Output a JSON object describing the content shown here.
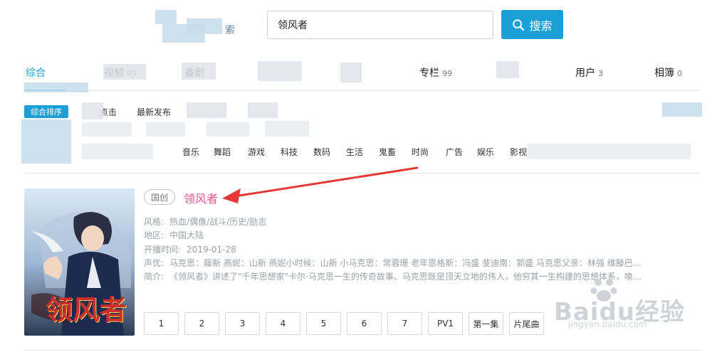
{
  "header": {
    "logo_partial": "索",
    "search": {
      "value": "领风者",
      "button_label": "搜索"
    }
  },
  "tabs": [
    {
      "label": "综合",
      "count": ""
    },
    {
      "label": "视频",
      "count": "99"
    },
    {
      "label": "番剧",
      "count": ""
    },
    {
      "label": "专栏",
      "count": "99"
    },
    {
      "label": "用户",
      "count": "3"
    },
    {
      "label": "相簿",
      "count": "0"
    }
  ],
  "filters": {
    "sort_badge": "综合排序",
    "items": [
      "点击",
      "最新发布"
    ]
  },
  "categories": [
    "音乐",
    "舞蹈",
    "游戏",
    "科技",
    "数码",
    "生活",
    "鬼畜",
    "时尚",
    "广告",
    "娱乐",
    "影视"
  ],
  "result": {
    "tag": "国创",
    "title": "领风者",
    "style_label": "风格:",
    "style_value": "热血/偶像/战斗/历史/励志",
    "region_label": "地区:",
    "region_value": "中国大陆",
    "date_label": "开播时间:",
    "date_value": "2019-01-28",
    "cast_label": "声优:",
    "cast_value": "马克思：藤新 燕妮：山新 燕妮小时候：山新 小马克思：常蓉珊 老年恩格斯：冯盛 斐迪南：郭盛 马克思父亲：林强 维滕巴赫校...",
    "intro_label": "简介:",
    "intro_value": "《领风者》讲述了\"千年思想家\"卡尔·马克思一生的传奇故事。马克思既是顶天立地的伟人，他穷其一生构建的思想体系，唤醒了...",
    "cover_caption": "领风者",
    "episodes": [
      "1",
      "2",
      "3",
      "4",
      "5",
      "6",
      "7",
      "PV1",
      "第一集",
      "片尾曲"
    ]
  },
  "watermark": {
    "brand": "Baidu经验",
    "url": "jingyan.baidu.com"
  },
  "colors": {
    "accent": "#1a9fd6",
    "title_pink": "#e8528a",
    "annotation_red": "#e53935"
  }
}
